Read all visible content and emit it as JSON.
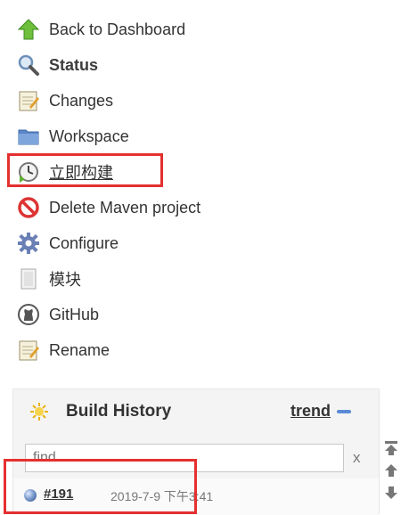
{
  "menu": [
    {
      "label": "Back to Dashboard",
      "icon": "up-arrow-icon",
      "color": "#6dbf3c"
    },
    {
      "label": "Status",
      "icon": "magnifier-icon"
    },
    {
      "label": "Changes",
      "icon": "notepad-icon"
    },
    {
      "label": "Workspace",
      "icon": "folder-icon"
    },
    {
      "label": "立即构建",
      "icon": "clock-build-icon"
    },
    {
      "label": "Delete Maven project",
      "icon": "no-entry-icon",
      "color": "#d33"
    },
    {
      "label": "Configure",
      "icon": "gear-icon"
    },
    {
      "label": "模块",
      "icon": "document-icon"
    },
    {
      "label": "GitHub",
      "icon": "github-icon"
    },
    {
      "label": "Rename",
      "icon": "notepad-icon"
    }
  ],
  "build_history": {
    "title": "Build History",
    "trend_label": "trend",
    "find_placeholder": "find",
    "clear_label": "x",
    "builds": [
      {
        "number": "#191",
        "date": "2019-7-9 下午3:41",
        "status_color": "#4a6fb0"
      }
    ]
  },
  "accent": "#e53030"
}
